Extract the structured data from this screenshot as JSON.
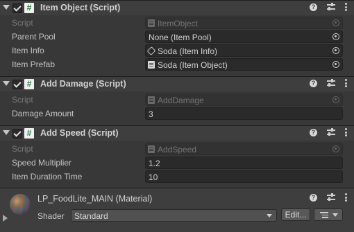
{
  "components": [
    {
      "title": "Item Object (Script)",
      "fields": [
        {
          "label": "Script",
          "value": "ItemObject",
          "disabled": true
        },
        {
          "label": "Parent Pool",
          "value": "None (Item Pool)"
        },
        {
          "label": "Item Info",
          "value": "Soda (Item Info)"
        },
        {
          "label": "Item Prefab",
          "value": "Soda (Item Object)"
        }
      ]
    },
    {
      "title": "Add Damage (Script)",
      "fields": [
        {
          "label": "Script",
          "value": "AddDamage",
          "disabled": true
        },
        {
          "label": "Damage Amount",
          "value": "3"
        }
      ]
    },
    {
      "title": "Add Speed (Script)",
      "fields": [
        {
          "label": "Script",
          "value": "AddSpeed",
          "disabled": true
        },
        {
          "label": "Speed Multiplier",
          "value": "1.2"
        },
        {
          "label": "Item Duration Time",
          "value": "10"
        }
      ]
    }
  ],
  "material": {
    "title": "LP_FoodLite_MAIN (Material)",
    "shader_label": "Shader",
    "shader_value": "Standard",
    "edit_label": "Edit..."
  },
  "header_icons": {
    "help": "?",
    "presets": "presets-icon",
    "menu": "kebab-icon"
  }
}
